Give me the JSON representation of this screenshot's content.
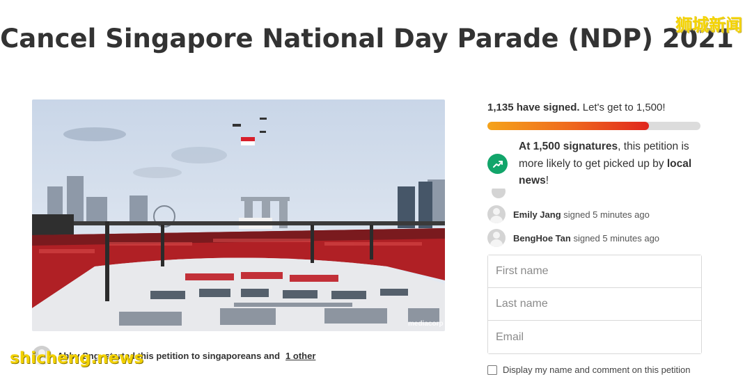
{
  "petition": {
    "title": "Cancel Singapore National Day Parade (NDP) 2021"
  },
  "watermarks": {
    "top": "狮城新闻",
    "bottom": "shicheng.news"
  },
  "hero_image": {
    "credit": "mediacorp"
  },
  "starter": {
    "name": "Abby Sng",
    "action": "started this petition to singaporeans and",
    "others_link": "1 other"
  },
  "signatures": {
    "count_strong": "1,135 have signed.",
    "count_rest": "Let's get to 1,500!",
    "current": 1135,
    "goal": 1500,
    "fill_fraction": 0.757
  },
  "promo": {
    "lead_bold": "At 1,500 signatures",
    "middle": ", this petition is more likely to get picked up by",
    "tail_bold": "local news",
    "end": "!"
  },
  "recent_signers": [
    {
      "name": "Emily Jang",
      "action": "signed 5 minutes ago"
    },
    {
      "name": "BengHoe Tan",
      "action": "signed 5 minutes ago"
    }
  ],
  "form": {
    "first_name_placeholder": "First name",
    "last_name_placeholder": "Last name",
    "email_placeholder": "Email",
    "display_checkbox_label": "Display my name and comment on this petition"
  },
  "colors": {
    "accent_green": "#12a56a",
    "progress_start": "#f5a31a",
    "progress_end": "#e0261e",
    "watermark_yellow": "#f4d300"
  }
}
